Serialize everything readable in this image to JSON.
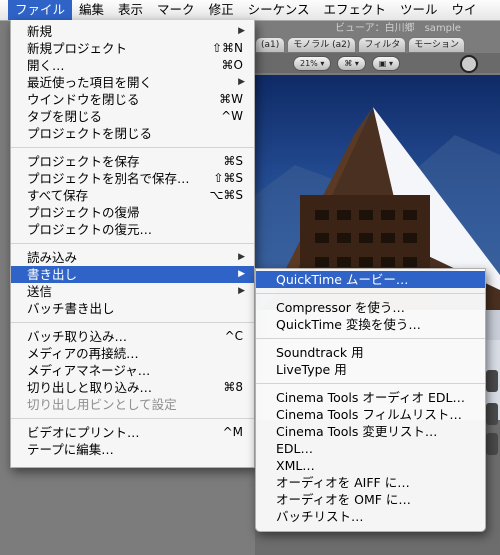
{
  "menubar": {
    "apple": "",
    "items": [
      "ファイル",
      "編集",
      "表示",
      "マーク",
      "修正",
      "シーケンス",
      "エフェクト",
      "ツール",
      "ウイ"
    ]
  },
  "viewer": {
    "title": "ビューア：白川郷　sample",
    "tabs": [
      "(a1)",
      "モノラル (a2)",
      "フィルタ",
      "モーション"
    ],
    "zoom": "21%"
  },
  "file_menu": {
    "groups": [
      [
        {
          "label": "新規",
          "shortcut": "",
          "submenu": true,
          "disabled": false
        },
        {
          "label": "新規プロジェクト",
          "shortcut": "⇧⌘N",
          "submenu": false,
          "disabled": false
        },
        {
          "label": "開く…",
          "shortcut": "⌘O",
          "submenu": false,
          "disabled": false
        },
        {
          "label": "最近使った項目を開く",
          "shortcut": "",
          "submenu": true,
          "disabled": false
        },
        {
          "label": "ウインドウを閉じる",
          "shortcut": "⌘W",
          "submenu": false,
          "disabled": false
        },
        {
          "label": "タブを閉じる",
          "shortcut": "^W",
          "submenu": false,
          "disabled": false
        },
        {
          "label": "プロジェクトを閉じる",
          "shortcut": "",
          "submenu": false,
          "disabled": false
        }
      ],
      [
        {
          "label": "プロジェクトを保存",
          "shortcut": "⌘S",
          "submenu": false,
          "disabled": false
        },
        {
          "label": "プロジェクトを別名で保存…",
          "shortcut": "⇧⌘S",
          "submenu": false,
          "disabled": false
        },
        {
          "label": "すべて保存",
          "shortcut": "⌥⌘S",
          "submenu": false,
          "disabled": false
        },
        {
          "label": "プロジェクトの復帰",
          "shortcut": "",
          "submenu": false,
          "disabled": false
        },
        {
          "label": "プロジェクトの復元…",
          "shortcut": "",
          "submenu": false,
          "disabled": false
        }
      ],
      [
        {
          "label": "読み込み",
          "shortcut": "",
          "submenu": true,
          "disabled": false
        },
        {
          "label": "書き出し",
          "shortcut": "",
          "submenu": true,
          "disabled": false,
          "highlighted": true
        },
        {
          "label": "送信",
          "shortcut": "",
          "submenu": true,
          "disabled": false
        },
        {
          "label": "バッチ書き出し",
          "shortcut": "",
          "submenu": false,
          "disabled": false
        }
      ],
      [
        {
          "label": "バッチ取り込み…",
          "shortcut": "^C",
          "submenu": false,
          "disabled": false
        },
        {
          "label": "メディアの再接続…",
          "shortcut": "",
          "submenu": false,
          "disabled": false
        },
        {
          "label": "メディアマネージャ…",
          "shortcut": "",
          "submenu": false,
          "disabled": false
        },
        {
          "label": "切り出しと取り込み…",
          "shortcut": "⌘8",
          "submenu": false,
          "disabled": false
        },
        {
          "label": "切り出し用ビンとして設定",
          "shortcut": "",
          "submenu": false,
          "disabled": true
        }
      ],
      [
        {
          "label": "ビデオにプリント…",
          "shortcut": "^M",
          "submenu": false,
          "disabled": false
        },
        {
          "label": "テープに編集…",
          "shortcut": "",
          "submenu": false,
          "disabled": false
        }
      ]
    ]
  },
  "export_submenu": {
    "groups": [
      [
        {
          "label": "QuickTime ムービー…",
          "highlighted": true
        }
      ],
      [
        {
          "label": "Compressor を使う…"
        },
        {
          "label": "QuickTime 変換を使う…"
        }
      ],
      [
        {
          "label": "Soundtrack 用"
        },
        {
          "label": "LiveType 用"
        }
      ],
      [
        {
          "label": "Cinema Tools オーディオ EDL…"
        },
        {
          "label": "Cinema Tools フィルムリスト…"
        },
        {
          "label": "Cinema Tools 変更リスト…"
        },
        {
          "label": "EDL…"
        },
        {
          "label": "XML…"
        },
        {
          "label": "オーディオを AIFF に…"
        },
        {
          "label": "オーディオを OMF に…"
        },
        {
          "label": "バッチリスト…"
        }
      ]
    ]
  },
  "colors": {
    "highlight": "#2f63c7",
    "menu_bg": "#fafafa",
    "disabled_text": "#8e8e8e"
  }
}
